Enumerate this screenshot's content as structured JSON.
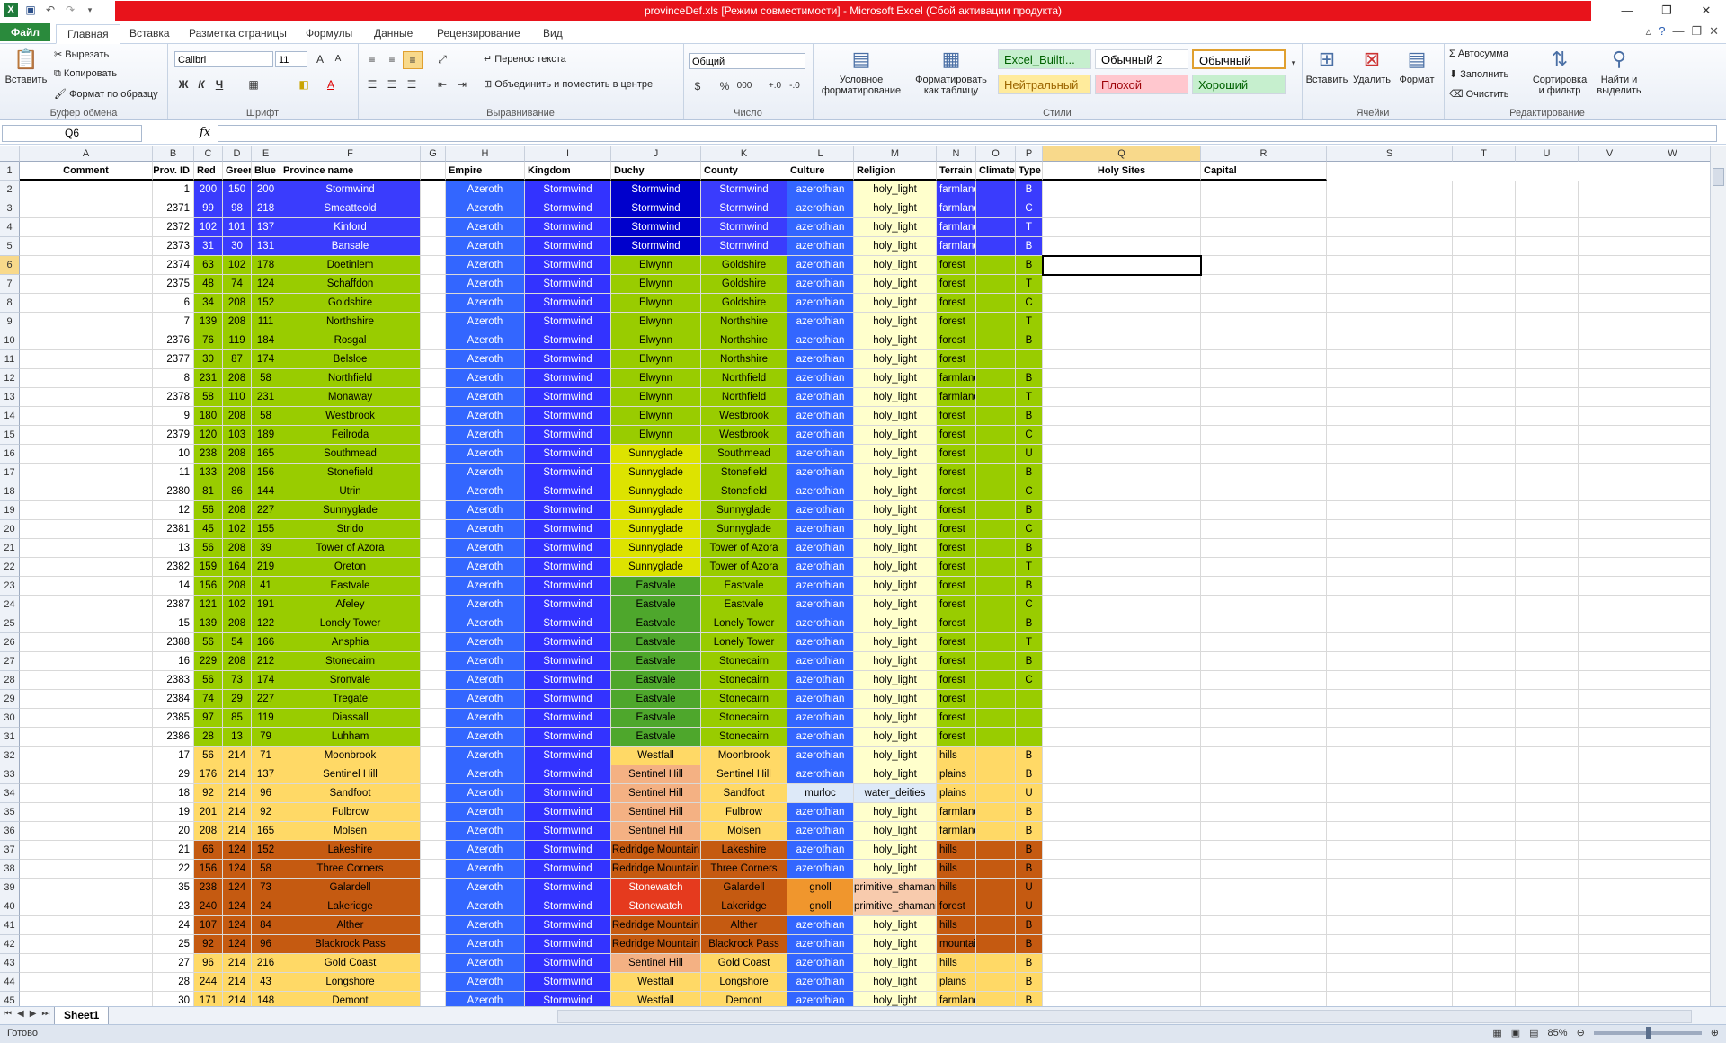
{
  "window": {
    "title": "provinceDef.xls  [Режим совместимости]  -  Microsoft Excel (Сбой активации продукта)",
    "controls": [
      "—",
      "❐",
      "✕"
    ]
  },
  "tabs": {
    "file": "Файл",
    "items": [
      "Главная",
      "Вставка",
      "Разметка страницы",
      "Формулы",
      "Данные",
      "Рецензирование",
      "Вид"
    ]
  },
  "ribbon": {
    "clipboard": {
      "paste": "Вставить",
      "cut": "Вырезать",
      "copy": "Копировать",
      "format_painter": "Формат по образцу",
      "label": "Буфер обмена"
    },
    "font": {
      "name": "Calibri",
      "size": "11",
      "bold": "Ж",
      "italic": "К",
      "underline": "Ч",
      "label": "Шрифт"
    },
    "alignment": {
      "wrap": "Перенос текста",
      "merge": "Объединить и поместить в центре",
      "label": "Выравнивание"
    },
    "number": {
      "format": "Общий",
      "label": "Число"
    },
    "styles": {
      "conditional": "Условное форматирование",
      "as_table": "Форматировать как таблицу",
      "cells": [
        {
          "text": "Excel_BuiltI...",
          "bg": "#c6efce",
          "fg": "#006100"
        },
        {
          "text": "Обычный 2",
          "bg": "#ffffff",
          "fg": "#000000"
        },
        {
          "text": "Обычный",
          "bg": "#ffffff",
          "fg": "#000000"
        },
        {
          "text": "Нейтральный",
          "bg": "#ffeb9c",
          "fg": "#9c6500"
        },
        {
          "text": "Плохой",
          "bg": "#ffc7ce",
          "fg": "#9c0006"
        },
        {
          "text": "Хороший",
          "bg": "#c6efce",
          "fg": "#006100"
        }
      ],
      "label": "Стили"
    },
    "cells": {
      "insert": "Вставить",
      "delete": "Удалить",
      "format": "Формат",
      "label": "Ячейки"
    },
    "editing": {
      "autosum": "Автосумма",
      "fill": "Заполнить",
      "clear": "Очистить",
      "sort": "Сортировка и фильтр",
      "find": "Найти и выделить",
      "label": "Редактирование"
    }
  },
  "formula_bar": {
    "name_box": "Q6",
    "fx": "fx",
    "content": ""
  },
  "columns": [
    "A",
    "B",
    "C",
    "D",
    "E",
    "F",
    "G",
    "H",
    "I",
    "J",
    "K",
    "L",
    "M",
    "N",
    "O",
    "P",
    "Q",
    "R",
    "S",
    "T",
    "U",
    "V",
    "W",
    "X"
  ],
  "headers": [
    "Comment",
    "Prov. ID",
    "Red",
    "Green",
    "Blue",
    "Province name",
    "",
    "Empire",
    "Kingdom",
    "Duchy",
    "County",
    "Culture",
    "Religion",
    "Terrain",
    "Climate",
    "Type",
    "Holy Sites",
    "Capital"
  ],
  "rows": [
    [
      "1",
      "200",
      "150",
      "200",
      "Stormwind",
      "Azeroth",
      "Stormwind",
      "Stormwind",
      "Stormwind",
      "azerothian",
      "holy_light",
      "farmlands",
      "B"
    ],
    [
      "2371",
      "99",
      "98",
      "218",
      "Smeatteold",
      "Azeroth",
      "Stormwind",
      "Stormwind",
      "Stormwind",
      "azerothian",
      "holy_light",
      "farmlands",
      "C"
    ],
    [
      "2372",
      "102",
      "101",
      "137",
      "Kinford",
      "Azeroth",
      "Stormwind",
      "Stormwind",
      "Stormwind",
      "azerothian",
      "holy_light",
      "farmlands",
      "T"
    ],
    [
      "2373",
      "31",
      "30",
      "131",
      "Bansale",
      "Azeroth",
      "Stormwind",
      "Stormwind",
      "Stormwind",
      "azerothian",
      "holy_light",
      "farmlands",
      "B"
    ],
    [
      "2374",
      "63",
      "102",
      "178",
      "Doetinlem",
      "Azeroth",
      "Stormwind",
      "Elwynn",
      "Goldshire",
      "azerothian",
      "holy_light",
      "forest",
      "B"
    ],
    [
      "2375",
      "48",
      "74",
      "124",
      "Schaffdon",
      "Azeroth",
      "Stormwind",
      "Elwynn",
      "Goldshire",
      "azerothian",
      "holy_light",
      "forest",
      "T"
    ],
    [
      "6",
      "34",
      "208",
      "152",
      "Goldshire",
      "Azeroth",
      "Stormwind",
      "Elwynn",
      "Goldshire",
      "azerothian",
      "holy_light",
      "forest",
      "C"
    ],
    [
      "7",
      "139",
      "208",
      "111",
      "Northshire",
      "Azeroth",
      "Stormwind",
      "Elwynn",
      "Northshire",
      "azerothian",
      "holy_light",
      "forest",
      "T"
    ],
    [
      "2376",
      "76",
      "119",
      "184",
      "Rosgal",
      "Azeroth",
      "Stormwind",
      "Elwynn",
      "Northshire",
      "azerothian",
      "holy_light",
      "forest",
      "B"
    ],
    [
      "2377",
      "30",
      "87",
      "174",
      "Belsloe",
      "Azeroth",
      "Stormwind",
      "Elwynn",
      "Northshire",
      "azerothian",
      "holy_light",
      "forest",
      ""
    ],
    [
      "8",
      "231",
      "208",
      "58",
      "Northfield",
      "Azeroth",
      "Stormwind",
      "Elwynn",
      "Northfield",
      "azerothian",
      "holy_light",
      "farmlands",
      "B"
    ],
    [
      "2378",
      "58",
      "110",
      "231",
      "Monaway",
      "Azeroth",
      "Stormwind",
      "Elwynn",
      "Northfield",
      "azerothian",
      "holy_light",
      "farmlands",
      "T"
    ],
    [
      "9",
      "180",
      "208",
      "58",
      "Westbrook",
      "Azeroth",
      "Stormwind",
      "Elwynn",
      "Westbrook",
      "azerothian",
      "holy_light",
      "forest",
      "B"
    ],
    [
      "2379",
      "120",
      "103",
      "189",
      "Feilroda",
      "Azeroth",
      "Stormwind",
      "Elwynn",
      "Westbrook",
      "azerothian",
      "holy_light",
      "forest",
      "C"
    ],
    [
      "10",
      "238",
      "208",
      "165",
      "Southmead",
      "Azeroth",
      "Stormwind",
      "Sunnyglade",
      "Southmead",
      "azerothian",
      "holy_light",
      "forest",
      "U"
    ],
    [
      "11",
      "133",
      "208",
      "156",
      "Stonefield",
      "Azeroth",
      "Stormwind",
      "Sunnyglade",
      "Stonefield",
      "azerothian",
      "holy_light",
      "forest",
      "B"
    ],
    [
      "2380",
      "81",
      "86",
      "144",
      "Utrin",
      "Azeroth",
      "Stormwind",
      "Sunnyglade",
      "Stonefield",
      "azerothian",
      "holy_light",
      "forest",
      "C"
    ],
    [
      "12",
      "56",
      "208",
      "227",
      "Sunnyglade",
      "Azeroth",
      "Stormwind",
      "Sunnyglade",
      "Sunnyglade",
      "azerothian",
      "holy_light",
      "forest",
      "B"
    ],
    [
      "2381",
      "45",
      "102",
      "155",
      "Strido",
      "Azeroth",
      "Stormwind",
      "Sunnyglade",
      "Sunnyglade",
      "azerothian",
      "holy_light",
      "forest",
      "C"
    ],
    [
      "13",
      "56",
      "208",
      "39",
      "Tower of Azora",
      "Azeroth",
      "Stormwind",
      "Sunnyglade",
      "Tower of Azora",
      "azerothian",
      "holy_light",
      "forest",
      "B"
    ],
    [
      "2382",
      "159",
      "164",
      "219",
      "Oreton",
      "Azeroth",
      "Stormwind",
      "Sunnyglade",
      "Tower of Azora",
      "azerothian",
      "holy_light",
      "forest",
      "T"
    ],
    [
      "14",
      "156",
      "208",
      "41",
      "Eastvale",
      "Azeroth",
      "Stormwind",
      "Eastvale",
      "Eastvale",
      "azerothian",
      "holy_light",
      "forest",
      "B"
    ],
    [
      "2387",
      "121",
      "102",
      "191",
      "Afeley",
      "Azeroth",
      "Stormwind",
      "Eastvale",
      "Eastvale",
      "azerothian",
      "holy_light",
      "forest",
      "C"
    ],
    [
      "15",
      "139",
      "208",
      "122",
      "Lonely Tower",
      "Azeroth",
      "Stormwind",
      "Eastvale",
      "Lonely Tower",
      "azerothian",
      "holy_light",
      "forest",
      "B"
    ],
    [
      "2388",
      "56",
      "54",
      "166",
      "Ansphia",
      "Azeroth",
      "Stormwind",
      "Eastvale",
      "Lonely Tower",
      "azerothian",
      "holy_light",
      "forest",
      "T"
    ],
    [
      "16",
      "229",
      "208",
      "212",
      "Stonecairn",
      "Azeroth",
      "Stormwind",
      "Eastvale",
      "Stonecairn",
      "azerothian",
      "holy_light",
      "forest",
      "B"
    ],
    [
      "2383",
      "56",
      "73",
      "174",
      "Sronvale",
      "Azeroth",
      "Stormwind",
      "Eastvale",
      "Stonecairn",
      "azerothian",
      "holy_light",
      "forest",
      "C"
    ],
    [
      "2384",
      "74",
      "29",
      "227",
      "Tregate",
      "Azeroth",
      "Stormwind",
      "Eastvale",
      "Stonecairn",
      "azerothian",
      "holy_light",
      "forest",
      ""
    ],
    [
      "2385",
      "97",
      "85",
      "119",
      "Diassall",
      "Azeroth",
      "Stormwind",
      "Eastvale",
      "Stonecairn",
      "azerothian",
      "holy_light",
      "forest",
      ""
    ],
    [
      "2386",
      "28",
      "13",
      "79",
      "Luhham",
      "Azeroth",
      "Stormwind",
      "Eastvale",
      "Stonecairn",
      "azerothian",
      "holy_light",
      "forest",
      ""
    ],
    [
      "17",
      "56",
      "214",
      "71",
      "Moonbrook",
      "Azeroth",
      "Stormwind",
      "Westfall",
      "Moonbrook",
      "azerothian",
      "holy_light",
      "hills",
      "B"
    ],
    [
      "29",
      "176",
      "214",
      "137",
      "Sentinel Hill",
      "Azeroth",
      "Stormwind",
      "Sentinel Hill",
      "Sentinel Hill",
      "azerothian",
      "holy_light",
      "plains",
      "B"
    ],
    [
      "18",
      "92",
      "214",
      "96",
      "Sandfoot",
      "Azeroth",
      "Stormwind",
      "Sentinel Hill",
      "Sandfoot",
      "murloc",
      "water_deities",
      "plains",
      "U"
    ],
    [
      "19",
      "201",
      "214",
      "92",
      "Fulbrow",
      "Azeroth",
      "Stormwind",
      "Sentinel Hill",
      "Fulbrow",
      "azerothian",
      "holy_light",
      "farmlands",
      "B"
    ],
    [
      "20",
      "208",
      "214",
      "165",
      "Molsen",
      "Azeroth",
      "Stormwind",
      "Sentinel Hill",
      "Molsen",
      "azerothian",
      "holy_light",
      "farmlands",
      "B"
    ],
    [
      "21",
      "66",
      "124",
      "152",
      "Lakeshire",
      "Azeroth",
      "Stormwind",
      "Redridge Mountain",
      "Lakeshire",
      "azerothian",
      "holy_light",
      "hills",
      "B"
    ],
    [
      "22",
      "156",
      "124",
      "58",
      "Three Corners",
      "Azeroth",
      "Stormwind",
      "Redridge Mountain",
      "Three Corners",
      "azerothian",
      "holy_light",
      "hills",
      "B"
    ],
    [
      "35",
      "238",
      "124",
      "73",
      "Galardell",
      "Azeroth",
      "Stormwind",
      "Stonewatch",
      "Galardell",
      "gnoll",
      "primitive_shamanism",
      "hills",
      "U"
    ],
    [
      "23",
      "240",
      "124",
      "24",
      "Lakeridge",
      "Azeroth",
      "Stormwind",
      "Stonewatch",
      "Lakeridge",
      "gnoll",
      "primitive_shamanism",
      "forest",
      "U"
    ],
    [
      "24",
      "107",
      "124",
      "84",
      "Alther",
      "Azeroth",
      "Stormwind",
      "Redridge Mountain",
      "Alther",
      "azerothian",
      "holy_light",
      "hills",
      "B"
    ],
    [
      "25",
      "92",
      "124",
      "96",
      "Blackrock Pass",
      "Azeroth",
      "Stormwind",
      "Redridge Mountain",
      "Blackrock Pass",
      "azerothian",
      "holy_light",
      "mountains",
      "B"
    ],
    [
      "27",
      "96",
      "214",
      "216",
      "Gold Coast",
      "Azeroth",
      "Stormwind",
      "Sentinel Hill",
      "Gold Coast",
      "azerothian",
      "holy_light",
      "hills",
      "B"
    ],
    [
      "28",
      "244",
      "214",
      "43",
      "Longshore",
      "Azeroth",
      "Stormwind",
      "Westfall",
      "Longshore",
      "azerothian",
      "holy_light",
      "plains",
      "B"
    ],
    [
      "30",
      "171",
      "214",
      "148",
      "Demont",
      "Azeroth",
      "Stormwind",
      "Westfall",
      "Demont",
      "azerothian",
      "holy_light",
      "farmlands",
      "B"
    ]
  ],
  "colors": {
    "blue_region": "#3a3cfd",
    "green_region": "#99cc00",
    "tan_region": "#ffd966",
    "brown_region": "#c55a11",
    "empire": "#3366ff",
    "kingdom": "#3333ff",
    "duchy_stormwind": "#0000cc",
    "duchy_sunny": "#dde300",
    "duchy_eastvale": "#4ea72c",
    "duchy_sentinel": "#f4b183",
    "duchy_stonewatch": "#e53a1e",
    "culture": "#3366ff",
    "culture_gnoll": "#f0962d",
    "religion": "#ffffcc",
    "religion_water": "#dde9f8",
    "religion_prim": "#f8cbad",
    "murloc": "#dde9f8"
  },
  "sheet": {
    "tab": "Sheet1"
  },
  "status": {
    "ready": "Готово",
    "zoom": "85%"
  }
}
